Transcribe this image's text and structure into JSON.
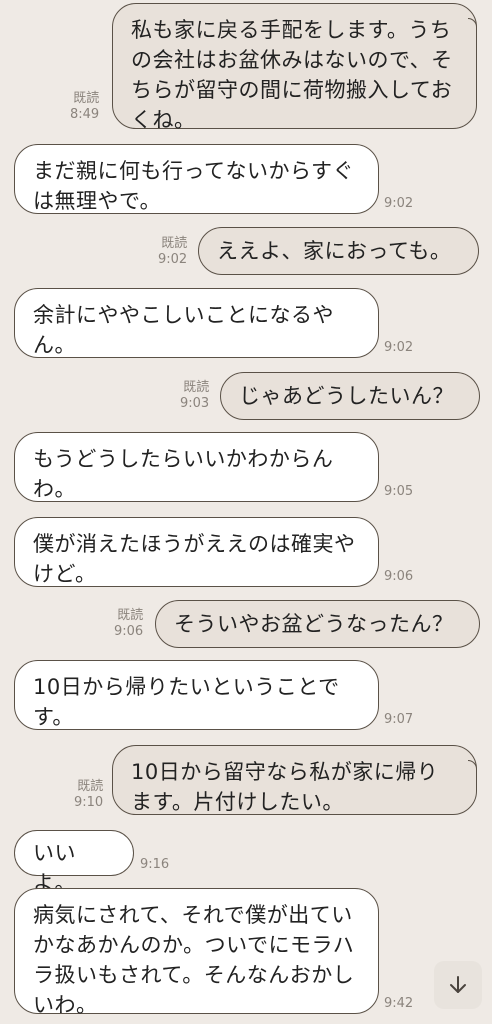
{
  "messages": [
    {
      "dir": "out",
      "text": "私も家に戻る手配をします。うちの会社はお盆休みはないので、そちらが留守の間に荷物搬入しておくね。",
      "read": "既読",
      "time": "8:49"
    },
    {
      "dir": "in",
      "text": "まだ親に何も行ってないからすぐは無理やで。",
      "time": "9:02"
    },
    {
      "dir": "out",
      "text": "ええよ、家におっても。",
      "read": "既読",
      "time": "9:02"
    },
    {
      "dir": "in",
      "text": "余計にややこしいことになるやん。",
      "time": "9:02"
    },
    {
      "dir": "out",
      "text": "じゃあどうしたいん？",
      "read": "既読",
      "time": "9:03"
    },
    {
      "dir": "in",
      "text": "もうどうしたらいいかわからんわ。",
      "time": "9:05"
    },
    {
      "dir": "in",
      "text": "僕が消えたほうがええのは確実やけど。",
      "time": "9:06"
    },
    {
      "dir": "out",
      "text": "そういやお盆どうなったん？",
      "read": "既読",
      "time": "9:06"
    },
    {
      "dir": "in",
      "text": "10日から帰りたいということです。",
      "time": "9:07"
    },
    {
      "dir": "out",
      "text": "10日から留守なら私が家に帰ります。片付けしたい。",
      "read": "既読",
      "time": "9:10"
    },
    {
      "dir": "in",
      "text": "いいよ。",
      "time": "9:16"
    },
    {
      "dir": "in",
      "text": "病気にされて、それで僕が出ていかなあかんのか。ついでにモラハラ扱いもされて。そんなんおかしいわ。",
      "time": "9:42"
    }
  ],
  "scroll_button": {
    "icon": "arrow-down-icon"
  },
  "colors": {
    "background": "#efeae5",
    "outgoing": "#e8e1da",
    "incoming": "#ffffff",
    "border": "#5a5147",
    "meta": "#8b847d"
  }
}
